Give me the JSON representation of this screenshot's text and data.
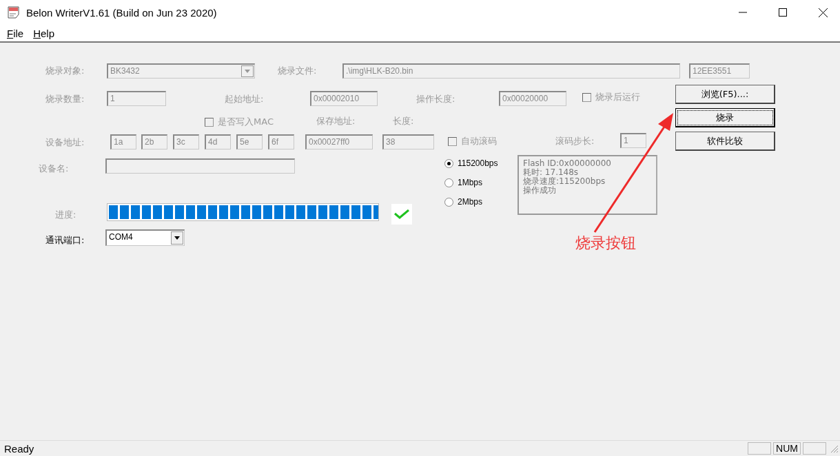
{
  "window": {
    "title": "Belon WriterV1.61 (Build on Jun 23 2020)"
  },
  "menu": [
    "File",
    "Help"
  ],
  "controls": [
    {
      "kind": "label",
      "text": "烧录对象:",
      "disabled": true
    },
    {
      "kind": "combo",
      "value": "BK3432",
      "disabled": true
    },
    {
      "kind": "label",
      "text": "烧录文件:",
      "disabled": true
    },
    {
      "kind": "input",
      "value": ".\\img\\HLK-B20.bin",
      "disabled": true
    },
    {
      "kind": "input",
      "value": "12EE3551",
      "disabled": true
    },
    {
      "kind": "label",
      "text": "烧录数量:",
      "disabled": true
    },
    {
      "kind": "input",
      "value": "1",
      "disabled": true
    },
    {
      "kind": "label",
      "text": "起始地址:",
      "disabled": true
    },
    {
      "kind": "input",
      "value": "0x00002010",
      "disabled": true
    },
    {
      "kind": "label",
      "text": "操作长度:",
      "disabled": true
    },
    {
      "kind": "input",
      "value": "0x00020000",
      "disabled": true
    },
    {
      "kind": "checkbox",
      "text": "烧录后运行",
      "checked": false,
      "disabled": true
    },
    {
      "kind": "button",
      "text": "浏览(F5)...:",
      "focused": false
    },
    {
      "kind": "checkbox",
      "text": "是否写入MAC",
      "checked": false,
      "disabled": true
    },
    {
      "kind": "label",
      "text": "保存地址:",
      "disabled": true
    },
    {
      "kind": "label",
      "text": "长度:",
      "disabled": true
    },
    {
      "kind": "button",
      "text": "烧录",
      "focused": true
    },
    {
      "kind": "label",
      "text": "设备地址:",
      "disabled": true
    },
    {
      "kind": "input",
      "value": "1a",
      "disabled": true
    },
    {
      "kind": "input",
      "value": "2b",
      "disabled": true
    },
    {
      "kind": "input",
      "value": "3c",
      "disabled": true
    },
    {
      "kind": "input",
      "value": "4d",
      "disabled": true
    },
    {
      "kind": "input",
      "value": "5e",
      "disabled": true
    },
    {
      "kind": "input",
      "value": "6f",
      "disabled": true
    },
    {
      "kind": "input",
      "value": "0x00027ff0",
      "disabled": true
    },
    {
      "kind": "input",
      "value": "38",
      "disabled": true
    },
    {
      "kind": "checkbox",
      "text": "自动滚码",
      "checked": false,
      "disabled": true
    },
    {
      "kind": "label",
      "text": "滚码步长:",
      "disabled": true
    },
    {
      "kind": "input",
      "value": "1",
      "disabled": true
    },
    {
      "kind": "button",
      "text": "软件比较",
      "focused": false
    },
    {
      "kind": "label",
      "text": "设备名:",
      "disabled": true
    },
    {
      "kind": "input",
      "disabled": true
    },
    {
      "kind": "radio",
      "text": "115200bps",
      "selected": true
    },
    {
      "kind": "radio",
      "text": "1Mbps",
      "selected": false
    },
    {
      "kind": "radio",
      "text": "2Mbps",
      "selected": false
    },
    {
      "kind": "log",
      "lines": [
        "Flash ID:0x00000000",
        "耗时: 17.148s",
        "烧录速度:115200bps",
        "操作成功"
      ]
    },
    {
      "kind": "label",
      "text": "进度:",
      "disabled": true
    },
    {
      "kind": "progress",
      "level": 1
    },
    {
      "kind": "success"
    },
    {
      "kind": "label",
      "text": "通讯端口:",
      "disabled": false
    },
    {
      "kind": "combo",
      "value": "COM4",
      "disabled": false
    }
  ],
  "annotation": {
    "text": "烧录按钮"
  },
  "status_bar": {
    "text": "Ready",
    "panes": [
      {
        "kind": "blank"
      },
      {
        "kind": "text",
        "text": "NUM"
      },
      {
        "kind": "blank"
      }
    ]
  }
}
